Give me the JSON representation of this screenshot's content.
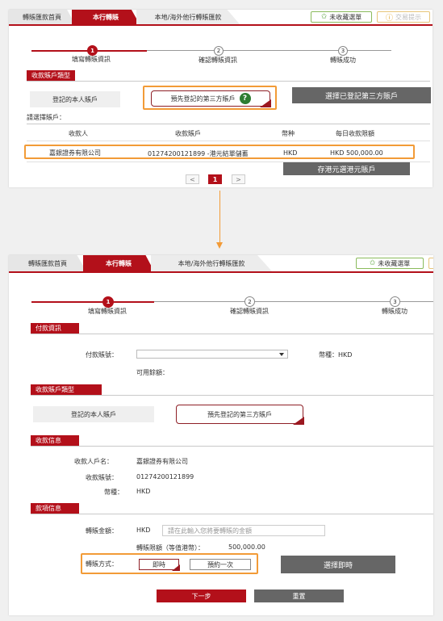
{
  "colors": {
    "brand": "#b3101a",
    "highlight": "#f29b37",
    "callout": "#666666",
    "confirm": "#2e7d32"
  },
  "panel1": {
    "tabs": [
      "轉賬匯款首頁",
      "本行轉賬",
      "本地/海外他行轉賬匯款"
    ],
    "fav_button": "未收藏選單",
    "tip_button": "交易提示",
    "steps": [
      {
        "num": "1",
        "label": "填寫轉賬資訊"
      },
      {
        "num": "2",
        "label": "確認轉賬資訊"
      },
      {
        "num": "3",
        "label": "轉賬成功"
      }
    ],
    "section_payee_type": "收款賬戶類型",
    "own_account": "登記的本人賬戶",
    "third_party": "預先登記的第三方賬戶",
    "callout_third_party": "選擇已登記第三方賬戶",
    "select_account_label": "請選擇賬戶：",
    "table_headers": [
      "收款人",
      "收款賬戶",
      "幣种",
      "每日收款限額"
    ],
    "table_row": {
      "payee": "嘉銀證券有限公司",
      "account": "01274200121899 -港元結單儲蓄",
      "currency": "HKD",
      "limit": "HKD 500,000.00"
    },
    "callout_hkd": "存港元選港元賬戶",
    "pagination": {
      "prev": "<",
      "page": "1",
      "next": ">"
    }
  },
  "panel2": {
    "tabs": [
      "轉賬匯款首頁",
      "本行轉賬",
      "本地/海外他行轉賬匯款"
    ],
    "fav_button": "未收藏選單",
    "steps": [
      {
        "num": "1",
        "label": "填寫轉賬資訊"
      },
      {
        "num": "2",
        "label": "確認轉賬資訊"
      },
      {
        "num": "3",
        "label": "轉賬成功"
      }
    ],
    "section_payment": "付款資訊",
    "pay_account_label": "付款賬號：",
    "currency_label": "幣種：HKD",
    "available_label": "可用餘額：",
    "section_payee_type": "收款賬戶類型",
    "own_account": "登記的本人賬戶",
    "third_party": "預先登記的第三方賬戶",
    "section_payee_info": "收款信息",
    "payee_name_label": "收款人戶名：",
    "payee_name": "嘉銀證券有限公司",
    "payee_account_label": "收款賬號：",
    "payee_account": "01274200121899",
    "payee_currency_label": "幣種：",
    "payee_currency": "HKD",
    "section_amount": "款項信息",
    "amount_label": "轉賬金額：",
    "amount_currency": "HKD",
    "amount_placeholder": "請在此輸入您將要轉賬的金額",
    "limit_label": "轉賬限額（等值港幣）：",
    "limit_value": "500,000.00",
    "mode_label": "轉賬方式：",
    "mode_instant": "即時",
    "mode_schedule": "預約一次",
    "callout_instant": "選擇即時",
    "next_button": "下一步",
    "reset_button": "重置"
  }
}
